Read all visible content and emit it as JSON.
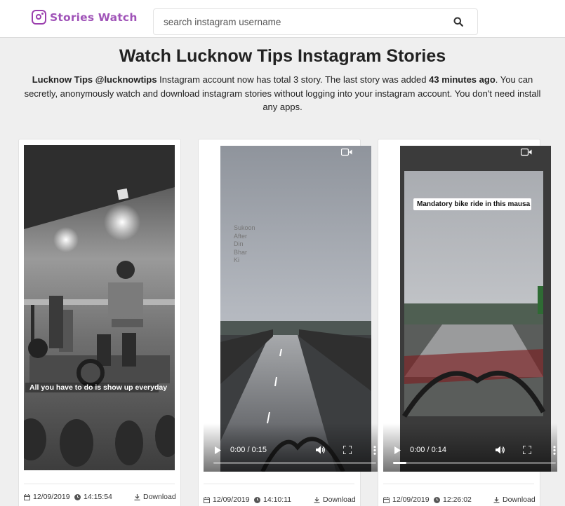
{
  "brand": {
    "name": "Stories Watch"
  },
  "search": {
    "placeholder": "search instagram username"
  },
  "page": {
    "title": "Watch Lucknow Tips Instagram Stories",
    "desc_account": "Lucknow Tips @lucknowtips",
    "desc_part1": " Instagram account now has total 3 story. The last story was added ",
    "desc_ago": "43 minutes ago",
    "desc_part2": ". You can secretly, anonymously watch and download instagram stories without logging into your instagram account. You don't need install any apps."
  },
  "stories": [
    {
      "type": "image",
      "caption": "All you have to do is show up everyday",
      "date": "12/09/2019",
      "time": "14:15:54",
      "download_label": "Download"
    },
    {
      "type": "video",
      "overlay_lines": [
        "Sukoon",
        "After",
        "Din",
        "Bhar",
        "Ki"
      ],
      "time_display": "0:00 / 0:15",
      "progress": 0,
      "date": "12/09/2019",
      "time": "14:10:11",
      "download_label": "Download"
    },
    {
      "type": "video",
      "caption": "Mandatory bike ride in this mausa",
      "time_display": "0:00 / 0:14",
      "progress": 0.08,
      "date": "12/09/2019",
      "time": "12:26:02",
      "download_label": "Download"
    }
  ],
  "colors": {
    "brand": "#a054b8",
    "page_bg": "#efefef"
  }
}
